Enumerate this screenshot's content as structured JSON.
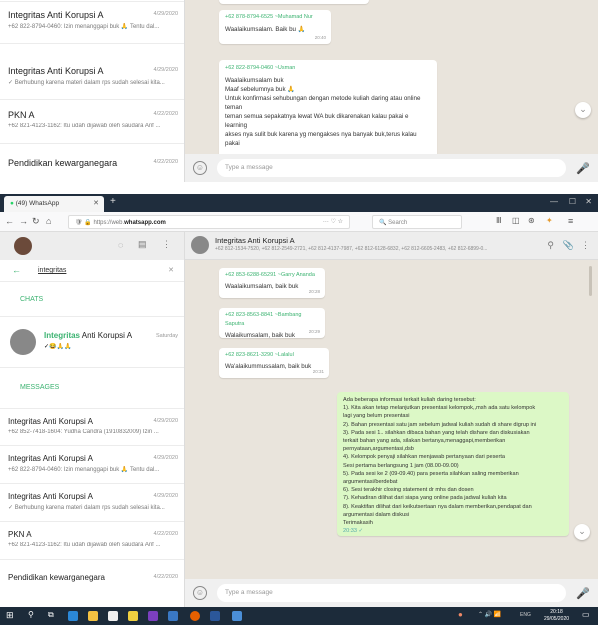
{
  "top": {
    "rows": [
      {
        "name": "Integritas Anti Korupsi A",
        "date": "4/29/2020",
        "preview": "+62 822-8794-0460: Izin menanggapi buk 🙏 Tentu dal..."
      },
      {
        "name": "Integritas Anti Korupsi A",
        "date": "4/29/2020",
        "preview": "✓ Berhubung karena materi dalam rps sudah selesai kita..."
      },
      {
        "name": "PKN A",
        "date": "4/22/2020",
        "preview": "+62 821-4123-1162: Itu udah dijawab oleh saudara Arif ..."
      },
      {
        "name": "Pendidikan kewarganegara",
        "date": "4/22/2020",
        "preview": ""
      }
    ],
    "bubble1": {
      "sender": "+62 878-8794-6525 ~Muhamad Nur",
      "text": "Waalaikumsalam. Baik bu 🙏",
      "time": "20:40"
    },
    "bubble2": {
      "sender": "+62 822-8794-0460 ~Usman",
      "lines": [
        "Waalaikumsalam buk",
        "Maaf sebelumnya buk 🙏",
        "Untuk konfirmasi sehubungan dengan metode kuliah daring atau online teman",
        "teman semua sepakatnya lewat WA buk dikarenakan kalau pakai e learning",
        "akses nya sulit buk karena yg mengakses nya banyak buk,terus kalau pakai"
      ]
    },
    "input_placeholder": "Type a message"
  },
  "browser": {
    "tab_title": "(49) WhatsApp",
    "url_prefix": "https://web.",
    "url_domain": "whatsapp.com",
    "search_placeholder": "Search",
    "nav_dots": "···"
  },
  "app": {
    "search_query": "integritas",
    "chats_label": "CHATS",
    "chat_name_bold": "Integritas",
    "chat_name_rest": " Anti Korupsi A",
    "chat_day": "Saturday",
    "chat_emoji": "✓😂🙏🙏",
    "messages_label": "MESSAGES",
    "msg_rows": [
      {
        "name": "Integritas Anti Korupsi A",
        "date": "4/29/2020",
        "preview": "+62 852-7418-1604: Yudha Candra (1910832009) Izin ..."
      },
      {
        "name": "Integritas Anti Korupsi A",
        "date": "4/29/2020",
        "preview": "+62 822-8794-0460: Izin menanggapi buk 🙏 Tentu dal..."
      },
      {
        "name": "Integritas Anti Korupsi A",
        "date": "4/29/2020",
        "preview": "✓ Berhubung karena materi dalam rps sudah selesai kita..."
      },
      {
        "name": "PKN A",
        "date": "4/22/2020",
        "preview": "+62 821-4123-1162: Itu udah dijawab oleh saudara Arif ..."
      },
      {
        "name": "Pendidikan kewarganegara",
        "date": "4/22/2020",
        "preview": ""
      }
    ],
    "header_title": "Integritas Anti Korupsi A",
    "header_members": "+62 812-1534-7520, +62 812-2549-2721, +62 812-4137-7987, +62 812-6128-6832, +62 812-6605-2483, +62 812-6899-0...",
    "in_bubbles": [
      {
        "sender": "+62 853-6288-65291 ~Garry Ananda",
        "text": "Waalaikumsalam, baik buk",
        "time": "20:28"
      },
      {
        "sender": "+62 823-8563-8841 ~Bambang Saputra",
        "text": "Walaikumsalam, baik buk",
        "time": "20:29"
      },
      {
        "sender": "+62 823-8621-3290 ~Lalalul",
        "text": "Wa'alaikummussalam, baik buk",
        "time": "20:31"
      }
    ],
    "out_lines": [
      "Ada beberapa informasi terkait kuliah daring tersebut:",
      "1). Kita akan tetap melanjutkan presentasi kelompok,,msh ada satu kelompok",
      "lagi yang belum presentasi",
      "2). Bahan presentasi satu jam sebelum jadwal kuliah sudah di share digrup ini",
      "3). Pada sesi 1.. silahkan dibaca bahan yang telah dishare dan diskusiakan",
      "terkait bahan yang ada, silakan bertanya,menaggapi,memberikan",
      "pernyataan,argumentasi,dsb",
      "4). Kelompok penyaji silahkan menjawab pertanyaan dari peserta",
      "Sesi pertama berlangsung 1 jam (08.00-09.00)",
      "5). Pada sesi ke 2 (09-09.40) para peserta silahkan saling memberikan",
      "argumentasi/berdebat",
      "6). Sesi terakhir closing statement dr mhs dan dosen",
      "7). Kehadiran dilihat dari siapa yang online pada jadwal kuliah kita",
      "8). Keaktifan dilihat dari keikutsertaan nya dalam memberikan,pendapat dan",
      "argumentasi dalam diskusi",
      "Terimakasih"
    ],
    "out_time": "20:33 ✓",
    "input_placeholder": "Type a message"
  },
  "taskbar": {
    "time": "20:18",
    "date": "29/05/2020",
    "tray": "ENG"
  },
  "colors": {
    "accent_green": "#3cb371",
    "taskbar": "#1c2b3a",
    "tabbar": "#1f2d3d"
  }
}
